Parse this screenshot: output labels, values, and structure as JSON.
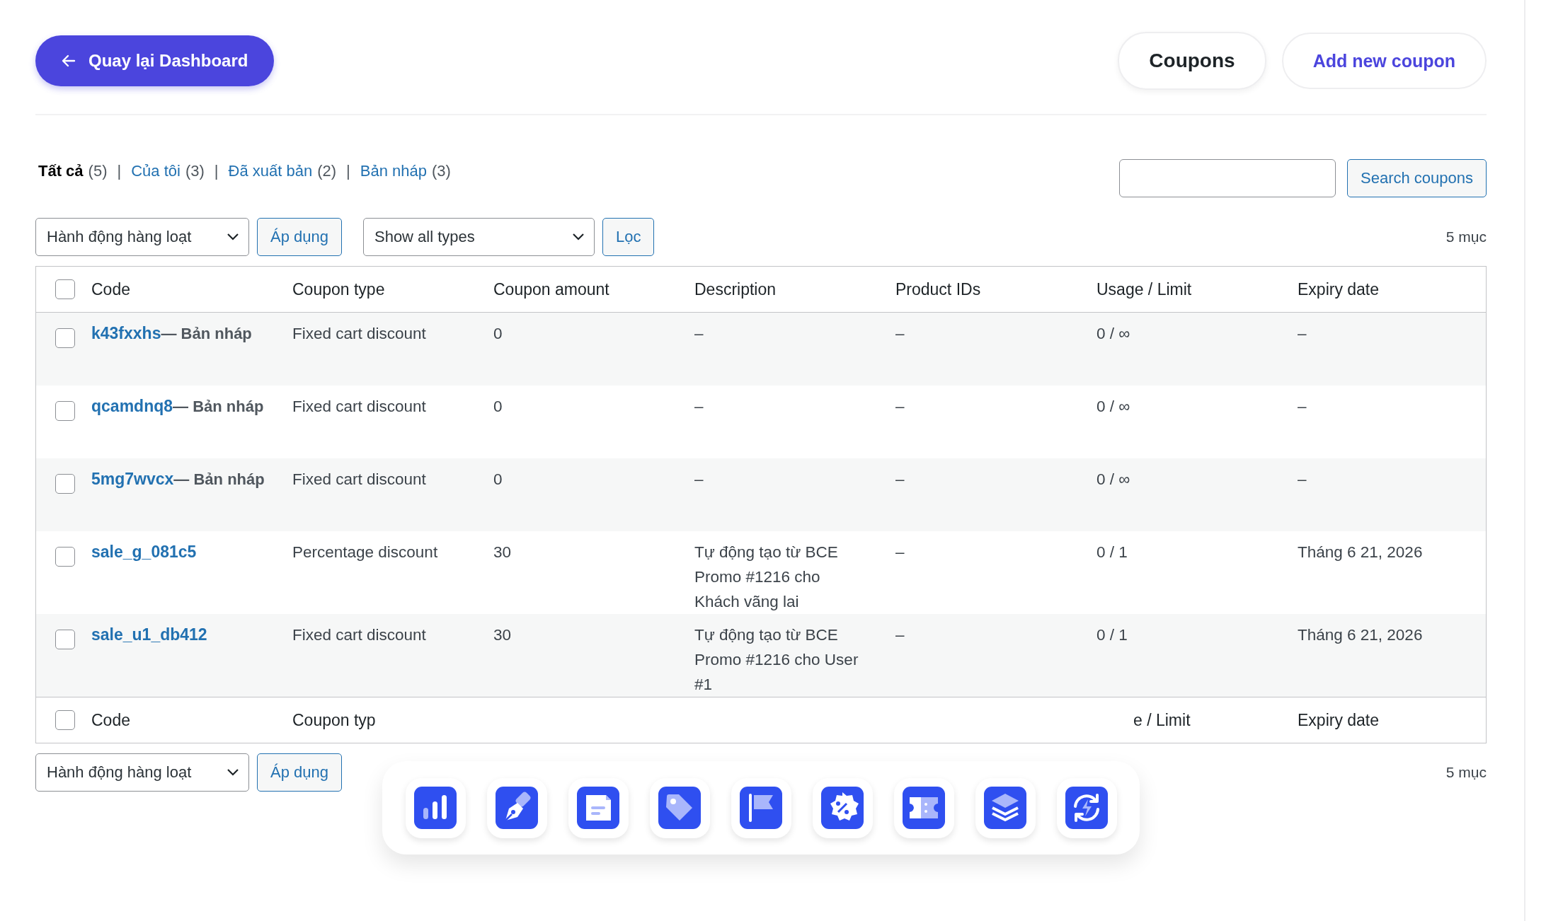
{
  "back_button": "Quay lại Dashboard",
  "nav": [
    {
      "label": "Coupons",
      "selected": true
    },
    {
      "label": "Add new coupon",
      "selected": false
    }
  ],
  "filters": {
    "separator": "|",
    "items": [
      {
        "label": "Tất cả",
        "count": "(5)",
        "selected": true
      },
      {
        "label": "Của tôi",
        "count": "(3)",
        "selected": false
      },
      {
        "label": "Đã xuất bản",
        "count": "(2)",
        "selected": false
      },
      {
        "label": "Bản nháp",
        "count": "(3)",
        "selected": false
      }
    ]
  },
  "search": {
    "button": "Search coupons"
  },
  "top_actions": {
    "bulk_select": "Hành động hàng loạt",
    "apply": "Áp dụng",
    "type_select": "Show all types",
    "filter": "Lọc",
    "count": "5 mục"
  },
  "table": {
    "select_all_checked": false,
    "columns": [
      "Code",
      "Coupon type",
      "Coupon amount",
      "Description",
      "Product IDs",
      "Usage / Limit",
      "Expiry date"
    ],
    "rows": [
      {
        "checked": false,
        "code": "k43fxxhs",
        "status": "— Bản nháp",
        "type": "Fixed cart discount",
        "amount": "0",
        "description": "–",
        "product_ids": "–",
        "usage": "0 / ∞",
        "expiry": "–"
      },
      {
        "checked": false,
        "code": "qcamdnq8",
        "status": "— Bản nháp",
        "type": "Fixed cart discount",
        "amount": "0",
        "description": "–",
        "product_ids": "–",
        "usage": "0 / ∞",
        "expiry": "–"
      },
      {
        "checked": false,
        "code": "5mg7wvcx",
        "status": "— Bản nháp",
        "type": "Fixed cart discount",
        "amount": "0",
        "description": "–",
        "product_ids": "–",
        "usage": "0 / ∞",
        "expiry": "–"
      },
      {
        "checked": false,
        "code": "sale_g_081c5",
        "type": "Percentage discount",
        "amount": "30",
        "description": "Tự động tạo từ BCE Promo #1216 cho Khách vãng lai",
        "product_ids": "–",
        "usage": "0 / 1",
        "expiry": "Tháng 6 21, 2026"
      },
      {
        "checked": false,
        "code": "sale_u1_db412",
        "type": "Fixed cart discount",
        "amount": "30",
        "description": "Tự động tạo từ BCE Promo #1216 cho User #1",
        "product_ids": "–",
        "usage": "0 / 1",
        "expiry": "Tháng 6 21, 2026"
      }
    ],
    "footer_checked": false,
    "footer_columns": [
      "Code",
      "Coupon typ",
      "e / Limit",
      "Expiry date"
    ]
  },
  "bottom_actions": {
    "bulk_select": "Hành động hàng loạt",
    "apply": "Áp dụng",
    "count": "5 mục"
  }
}
